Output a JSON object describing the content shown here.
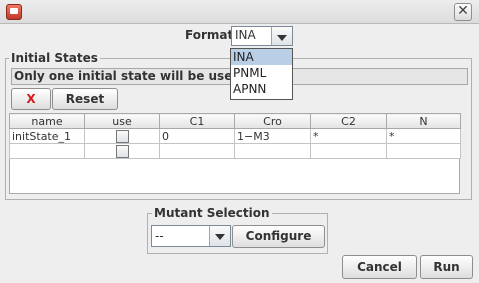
{
  "window": {
    "close_glyph": "✕"
  },
  "format": {
    "label": "Format",
    "value": "INA",
    "options": [
      "INA",
      "PNML",
      "APNN"
    ],
    "highlighted": "INA"
  },
  "initial_states": {
    "title": "Initial States",
    "info": "Only one initial state will be used",
    "delete_glyph": "X",
    "reset_label": "Reset",
    "columns": [
      "name",
      "use",
      "C1",
      "Cro",
      "C2",
      "N"
    ],
    "rows": [
      {
        "name": "initState_1",
        "c1": "0",
        "cro": "1−M3",
        "c2": "*",
        "n": "*"
      },
      {
        "name": "",
        "c1": "",
        "cro": "",
        "c2": "",
        "n": ""
      }
    ]
  },
  "mutant_selection": {
    "title": "Mutant Selection",
    "value": "--",
    "configure_label": "Configure"
  },
  "footer": {
    "cancel_label": "Cancel",
    "run_label": "Run"
  }
}
